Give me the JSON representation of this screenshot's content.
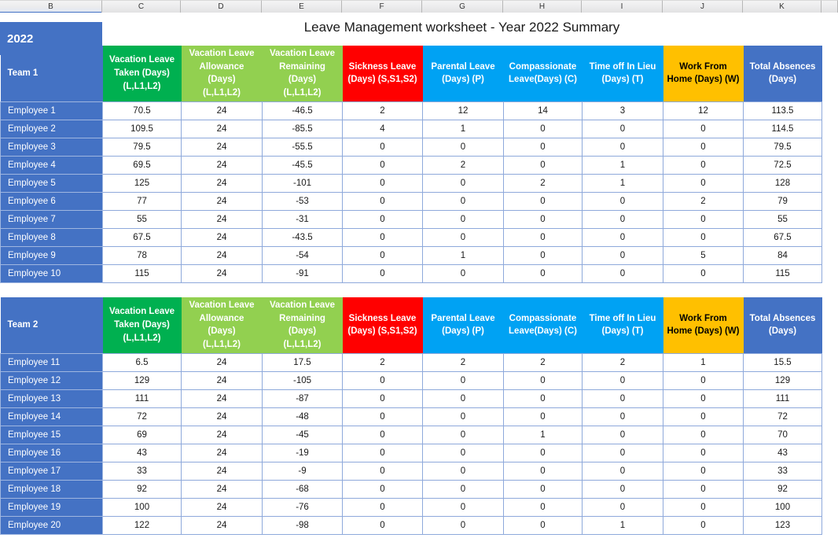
{
  "app": {
    "title": "Leave Management worksheet - Year 2022 Summary",
    "year": "2022"
  },
  "column_headers": [
    "B",
    "C",
    "D",
    "E",
    "F",
    "G",
    "H",
    "I",
    "J",
    "K"
  ],
  "colors": {
    "vacation_taken": "#00b050",
    "vacation_allowance": "#92d050",
    "vacation_remaining": "#92d050",
    "sickness": "#ff0000",
    "parental": "#00a2f3",
    "compassionate": "#00a2f3",
    "time_off_lieu": "#00a2f3",
    "work_from_home": "#ffc000",
    "total_absences": "#4472c4",
    "row_label": "#4472c4",
    "grid": "#8ea9db"
  },
  "headers": [
    "Vacation Leave Taken (Days) (L,L1,L2)",
    "Vacation Leave Allowance (Days) (L,L1,L2)",
    "Vacation Leave Remaining (Days) (L,L1,L2)",
    "Sickness Leave (Days) (S,S1,S2)",
    "Parental Leave (Days) (P)",
    "Compassionate Leave(Days) (C)",
    "Time off In Lieu (Days) (T)",
    "Work From Home (Days) (W)",
    "Total Absences (Days)"
  ],
  "header_lines": [
    [
      "Vacation Leave",
      "Taken (Days)",
      "(L,L1,L2)"
    ],
    [
      "Vacation Leave",
      "Allowance (Days)",
      "(L,L1,L2)"
    ],
    [
      "Vacation Leave",
      "Remaining (Days)",
      "(L,L1,L2)"
    ],
    [
      "Sickness Leave",
      "(Days) (S,S1,S2)"
    ],
    [
      "Parental Leave",
      "(Days) (P)"
    ],
    [
      "Compassionate",
      "Leave(Days) (C)"
    ],
    [
      "Time off In Lieu",
      "(Days) (T)"
    ],
    [
      "Work From",
      "Home (Days) (W)"
    ],
    [
      "Total Absences",
      "(Days)"
    ]
  ],
  "tables": [
    {
      "team_label": "Team 1",
      "rows": [
        {
          "name": "Employee 1",
          "values": [
            "70.5",
            "24",
            "-46.5",
            "2",
            "12",
            "14",
            "3",
            "12",
            "113.5"
          ]
        },
        {
          "name": "Employee 2",
          "values": [
            "109.5",
            "24",
            "-85.5",
            "4",
            "1",
            "0",
            "0",
            "0",
            "114.5"
          ]
        },
        {
          "name": "Employee 3",
          "values": [
            "79.5",
            "24",
            "-55.5",
            "0",
            "0",
            "0",
            "0",
            "0",
            "79.5"
          ]
        },
        {
          "name": "Employee 4",
          "values": [
            "69.5",
            "24",
            "-45.5",
            "0",
            "2",
            "0",
            "1",
            "0",
            "72.5"
          ]
        },
        {
          "name": "Employee 5",
          "values": [
            "125",
            "24",
            "-101",
            "0",
            "0",
            "2",
            "1",
            "0",
            "128"
          ]
        },
        {
          "name": "Employee 6",
          "values": [
            "77",
            "24",
            "-53",
            "0",
            "0",
            "0",
            "0",
            "2",
            "79"
          ]
        },
        {
          "name": "Employee 7",
          "values": [
            "55",
            "24",
            "-31",
            "0",
            "0",
            "0",
            "0",
            "0",
            "55"
          ]
        },
        {
          "name": "Employee 8",
          "values": [
            "67.5",
            "24",
            "-43.5",
            "0",
            "0",
            "0",
            "0",
            "0",
            "67.5"
          ]
        },
        {
          "name": "Employee 9",
          "values": [
            "78",
            "24",
            "-54",
            "0",
            "1",
            "0",
            "0",
            "5",
            "84"
          ]
        },
        {
          "name": "Employee 10",
          "values": [
            "115",
            "24",
            "-91",
            "0",
            "0",
            "0",
            "0",
            "0",
            "115"
          ]
        }
      ]
    },
    {
      "team_label": "Team 2",
      "rows": [
        {
          "name": "Employee 11",
          "values": [
            "6.5",
            "24",
            "17.5",
            "2",
            "2",
            "2",
            "2",
            "1",
            "15.5"
          ]
        },
        {
          "name": "Employee 12",
          "values": [
            "129",
            "24",
            "-105",
            "0",
            "0",
            "0",
            "0",
            "0",
            "129"
          ]
        },
        {
          "name": "Employee 13",
          "values": [
            "111",
            "24",
            "-87",
            "0",
            "0",
            "0",
            "0",
            "0",
            "111"
          ]
        },
        {
          "name": "Employee 14",
          "values": [
            "72",
            "24",
            "-48",
            "0",
            "0",
            "0",
            "0",
            "0",
            "72"
          ]
        },
        {
          "name": "Employee 15",
          "values": [
            "69",
            "24",
            "-45",
            "0",
            "0",
            "1",
            "0",
            "0",
            "70"
          ]
        },
        {
          "name": "Employee 16",
          "values": [
            "43",
            "24",
            "-19",
            "0",
            "0",
            "0",
            "0",
            "0",
            "43"
          ]
        },
        {
          "name": "Employee 17",
          "values": [
            "33",
            "24",
            "-9",
            "0",
            "0",
            "0",
            "0",
            "0",
            "33"
          ]
        },
        {
          "name": "Employee 18",
          "values": [
            "92",
            "24",
            "-68",
            "0",
            "0",
            "0",
            "0",
            "0",
            "92"
          ]
        },
        {
          "name": "Employee 19",
          "values": [
            "100",
            "24",
            "-76",
            "0",
            "0",
            "0",
            "0",
            "0",
            "100"
          ]
        },
        {
          "name": "Employee 20",
          "values": [
            "122",
            "24",
            "-98",
            "0",
            "0",
            "0",
            "1",
            "0",
            "123"
          ]
        }
      ]
    }
  ]
}
